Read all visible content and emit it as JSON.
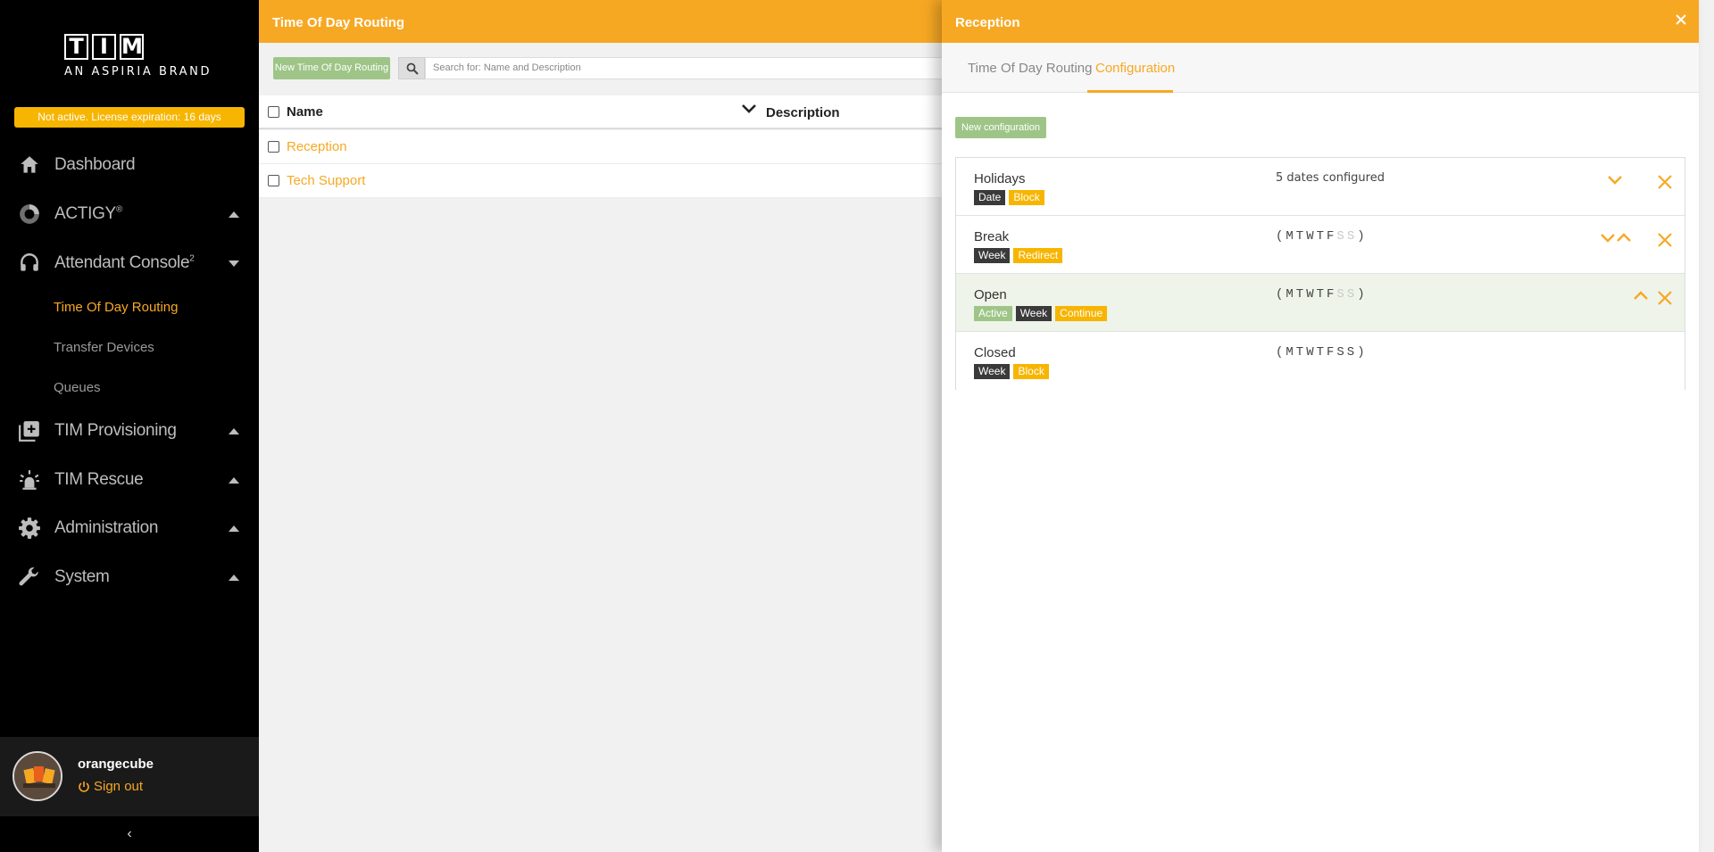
{
  "brand": {
    "letters": [
      "T",
      "I",
      "M"
    ],
    "subtitle": "AN ASPIRIA BRAND"
  },
  "license_text": "Not active. License expiration: 16 days",
  "nav": {
    "dashboard": "Dashboard",
    "actigy": "ACTIGY",
    "actigy_sup": "®",
    "attendant": "Attendant Console",
    "attendant_sup": "2",
    "sub_tod": "Time Of Day Routing",
    "sub_transfer": "Transfer Devices",
    "sub_queues": "Queues",
    "provisioning": "TIM Provisioning",
    "rescue": "TIM Rescue",
    "administration": "Administration",
    "system": "System"
  },
  "user": {
    "name": "orangecube",
    "signout": "Sign out"
  },
  "collapse_glyph": "‹",
  "main": {
    "title": "Time Of Day Routing",
    "new_button": "New Time Of Day Routing",
    "search_placeholder": "Search for: Name and Description",
    "col_name": "Name",
    "col_description": "Description",
    "rows": [
      {
        "name": "Reception"
      },
      {
        "name": "Tech Support"
      }
    ]
  },
  "panel": {
    "title": "Reception",
    "tabs": [
      "Time Of Day Routing",
      "Configuration"
    ],
    "active_tab": "Configuration",
    "new_config": "New configuration",
    "configs": [
      {
        "name": "Holidays",
        "tags": [
          "Date",
          "Block"
        ],
        "summary": "5 dates configured"
      },
      {
        "name": "Break",
        "tags": [
          "Week",
          "Redirect"
        ],
        "days_open": "(MTWTF",
        "days_off": "SS",
        "days_close": ")"
      },
      {
        "name": "Open",
        "tags": [
          "Active",
          "Week",
          "Continue"
        ],
        "days_open": "(MTWTF",
        "days_off": "SS",
        "days_close": ")"
      },
      {
        "name": "Closed",
        "tags": [
          "Week",
          "Block"
        ],
        "days_open": "(MTWTFSS",
        "days_off": "",
        "days_close": ")"
      }
    ]
  },
  "colors": {
    "accent": "#f7a823",
    "license": "#f7b500",
    "green_button": "#9ec587",
    "sidebar_bg": "#000000"
  }
}
